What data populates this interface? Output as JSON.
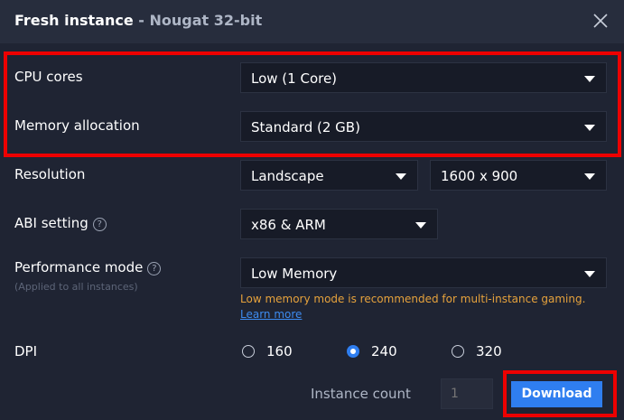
{
  "dialog": {
    "title": "Fresh instance",
    "subtitle": "- Nougat 32-bit"
  },
  "cpu": {
    "label": "CPU cores",
    "value": "Low (1 Core)"
  },
  "memory": {
    "label": "Memory allocation",
    "value": "Standard (2 GB)"
  },
  "resolution": {
    "label": "Resolution",
    "orientation": "Landscape",
    "size": "1600 x 900"
  },
  "abi": {
    "label": "ABI setting",
    "help": "?",
    "value": "x86 & ARM"
  },
  "performance": {
    "label": "Performance mode",
    "help": "?",
    "sublabel": "(Applied to all instances)",
    "value": "Low Memory",
    "warning": "Low memory mode is recommended for multi-instance gaming.",
    "learn_more": "Learn more"
  },
  "dpi": {
    "label": "DPI",
    "options": [
      "160",
      "240",
      "320"
    ],
    "selected": "240"
  },
  "instance_count": {
    "label": "Instance count",
    "placeholder": "1"
  },
  "download_label": "Download",
  "colors": {
    "highlight": "#ee0000",
    "accent": "#2f7ef0",
    "warning": "#e6a23c",
    "link": "#3d8bf0"
  }
}
